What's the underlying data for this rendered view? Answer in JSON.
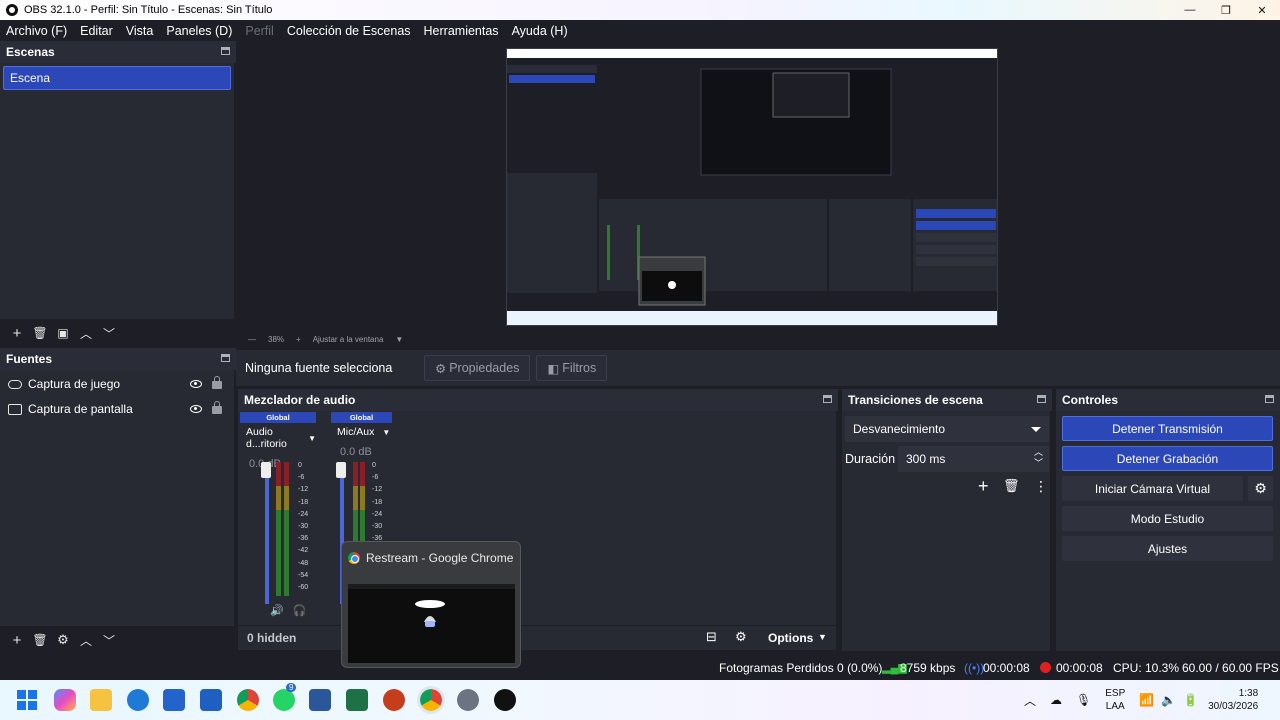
{
  "window": {
    "title": "OBS 32.1.0 - Perfil: Sin Título - Escenas: Sin Título",
    "controls": [
      "—",
      "❐",
      "✕"
    ]
  },
  "menu": {
    "items": [
      {
        "label": "Archivo (F)",
        "enabled": true
      },
      {
        "label": "Editar",
        "enabled": true
      },
      {
        "label": "Vista",
        "enabled": true
      },
      {
        "label": "Paneles (D)",
        "enabled": true
      },
      {
        "label": "Perfil",
        "enabled": false
      },
      {
        "label": "Colección de Escenas",
        "enabled": true
      },
      {
        "label": "Herramientas",
        "enabled": true
      },
      {
        "label": "Ayuda (H)",
        "enabled": true
      }
    ]
  },
  "scenes": {
    "title": "Escenas",
    "items": [
      "Escena"
    ],
    "selected": "Escena"
  },
  "sources": {
    "title": "Fuentes",
    "items": [
      {
        "label": "Captura de juego",
        "icon": "gamepad-icon"
      },
      {
        "label": "Captura de pantalla",
        "icon": "monitor-icon"
      }
    ]
  },
  "preview": {
    "zoom": "38%",
    "fit_label": "Ajustar a la ventana"
  },
  "context": {
    "no_source": "Ninguna fuente selecciona",
    "properties": "Propiedades",
    "filters": "Filtros"
  },
  "mixer": {
    "title": "Mezclador de audio",
    "channels": [
      {
        "scope": "Global",
        "name": "Audio d...ritorio",
        "db": "0.0 dB"
      },
      {
        "scope": "Global",
        "name": "Mic/Aux",
        "db": "0.0 dB"
      }
    ],
    "ticks": [
      "0",
      "-6",
      "-12",
      "-18",
      "-24",
      "-30",
      "-36",
      "-42",
      "-48",
      "-54",
      "-60"
    ],
    "hidden_label": "0 hidden",
    "options_label": "Options"
  },
  "transitions": {
    "title": "Transiciones de escena",
    "selected": "Desvanecimiento",
    "duration_label": "Duración",
    "duration_value": "300 ms"
  },
  "controls": {
    "title": "Controles",
    "stop_stream": "Detener Transmisión",
    "stop_record": "Detener Grabación",
    "virtual_cam": "Iniciar Cámara Virtual",
    "studio_mode": "Modo Estudio",
    "settings": "Ajustes"
  },
  "status": {
    "dropped_frames": "Fotogramas Perdidos 0 (0.0%)",
    "bitrate": "8759 kbps",
    "stream_time": "00:00:08",
    "record_time": "00:00:08",
    "cpu": "CPU: 10.3%",
    "fps": "60.00 / 60.00 FPS"
  },
  "popup": {
    "title": "Restream - Google Chrome"
  },
  "taskbar": {
    "whatsapp_badge": "9",
    "lang": "ESP",
    "lang_sub": "LAA",
    "time": "1:38",
    "date": "30/03/2026"
  },
  "colors": {
    "accent": "#2c48b8",
    "panel": "#272a33",
    "background": "#1e1f26",
    "record": "#e02020",
    "bitrate": "#2fbf3a"
  }
}
